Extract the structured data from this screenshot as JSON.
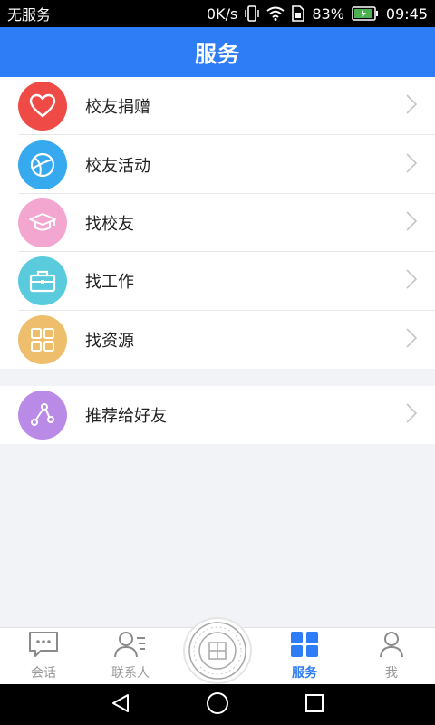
{
  "status_bar": {
    "carrier": "无服务",
    "speed": "0K/s",
    "battery": "83%",
    "time": "09:45"
  },
  "header": {
    "title": "服务"
  },
  "menu": {
    "items": [
      {
        "label": "校友捐赠",
        "icon": "heart-icon",
        "color": "#ef4a45"
      },
      {
        "label": "校友活动",
        "icon": "ball-icon",
        "color": "#37a9ee"
      },
      {
        "label": "找校友",
        "icon": "graduation-cap-icon",
        "color": "#f3a6cf"
      },
      {
        "label": "找工作",
        "icon": "briefcase-icon",
        "color": "#59cbdd"
      },
      {
        "label": "找资源",
        "icon": "grid-icon",
        "color": "#efbe6d"
      }
    ],
    "share": {
      "label": "推荐给好友",
      "icon": "share-icon",
      "color": "#b98be6"
    }
  },
  "tabbar": {
    "tabs": [
      {
        "label": "会话",
        "icon": "chat-icon"
      },
      {
        "label": "联系人",
        "icon": "contacts-icon"
      },
      {
        "label": "",
        "icon": "university-seal-icon"
      },
      {
        "label": "服务",
        "icon": "services-icon",
        "active": true
      },
      {
        "label": "我",
        "icon": "person-icon"
      }
    ]
  },
  "colors": {
    "primary": "#2e7cf6",
    "background": "#f1f3f7"
  }
}
